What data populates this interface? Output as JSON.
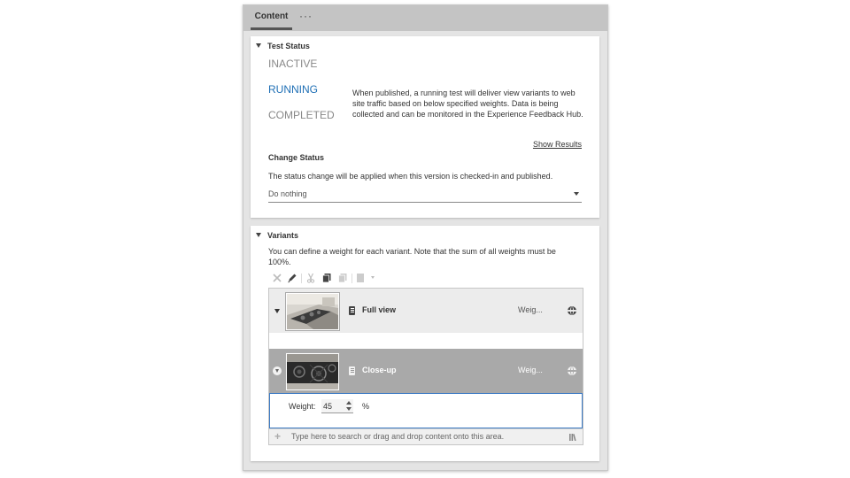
{
  "tabs": {
    "content_label": "Content",
    "more_label": "···"
  },
  "test_status": {
    "heading": "Test Status",
    "options": {
      "inactive": "INACTIVE",
      "running": "RUNNING",
      "completed": "COMPLETED"
    },
    "selected": "RUNNING",
    "description": "When published, a running test will deliver view variants to web site traffic based on below specified weights. Data is being collected and can be monitored in the Experience Feedback Hub.",
    "show_results": "Show Results"
  },
  "change_status": {
    "heading": "Change Status",
    "note": "The status change will be applied when this version is checked-in and published.",
    "select_value": "Do nothing"
  },
  "variants": {
    "heading": "Variants",
    "note": "You can define a weight for each variant. Note that the sum of all weights must be 100%.",
    "toolbar": [
      "delete-icon",
      "edit-icon",
      "cut-icon",
      "copy-icon",
      "paste-icon",
      "insert-icon"
    ],
    "items": [
      {
        "name": "Full view",
        "weight_label": "Weig..."
      },
      {
        "name": "Close-up",
        "weight_label": "Weig..."
      }
    ],
    "editor": {
      "weight_label": "Weight:",
      "weight_value": "45",
      "unit": "%"
    },
    "drop_placeholder": "Type here to search or drag and drop content onto this area."
  },
  "colors": {
    "accent": "#1e6fb5",
    "selected_row": "#a9a9a9",
    "focus_border": "#3b7ac4"
  }
}
